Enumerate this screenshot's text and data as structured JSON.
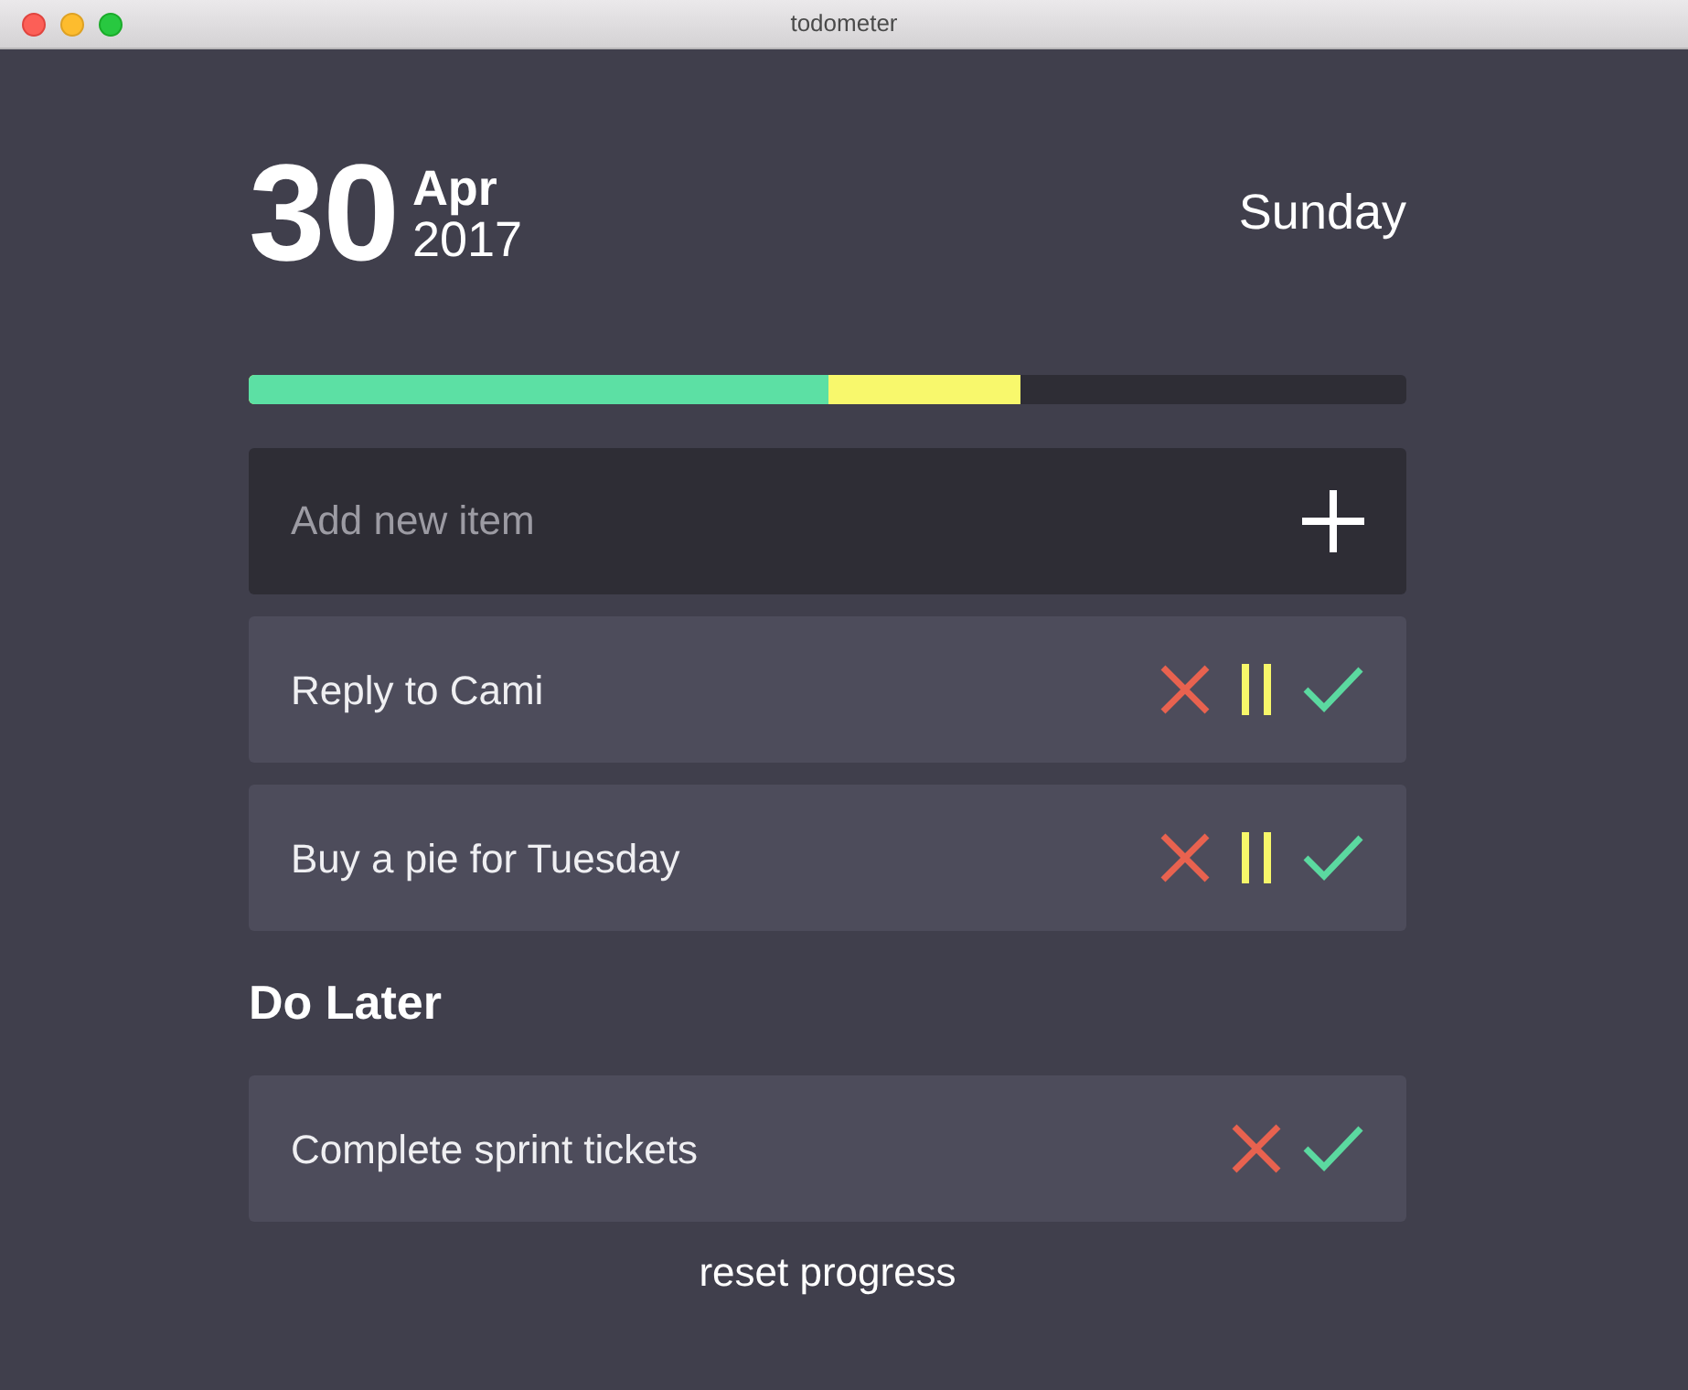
{
  "window": {
    "title": "todometer"
  },
  "date": {
    "day": "30",
    "month": "Apr",
    "year": "2017",
    "weekday": "Sunday"
  },
  "progress": {
    "fills": [
      {
        "color": "#5ce0a4",
        "level": 0.5
      },
      {
        "color": "#f8f86c",
        "level": 0.667
      }
    ]
  },
  "new_item": {
    "placeholder": "Add new item"
  },
  "items": [
    {
      "text": "Reply to Cami",
      "kind": "active"
    },
    {
      "text": "Buy a pie for Tuesday",
      "kind": "active"
    }
  ],
  "do_later": {
    "heading": "Do Later",
    "items": [
      {
        "text": "Complete sprint tickets",
        "kind": "paused"
      }
    ]
  },
  "reset_button": "reset progress"
}
